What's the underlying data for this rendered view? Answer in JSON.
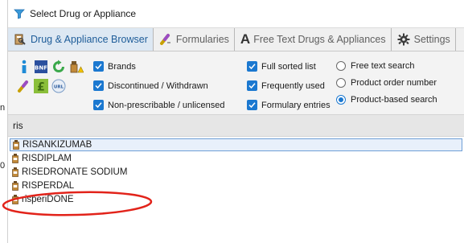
{
  "behind_window": {
    "glyph_a": "n",
    "glyph_b": "0"
  },
  "window": {
    "title": "Select Drug or Appliance",
    "icon": "funnel-icon"
  },
  "tabs": [
    {
      "label": "Drug & Appliance Browser",
      "icon": "book-icon",
      "active": true
    },
    {
      "label": "Formularies",
      "icon": "pill-icon",
      "active": false
    },
    {
      "label": "Free Text Drugs & Appliances",
      "icon": "letter-a-icon",
      "active": false
    },
    {
      "label": "Settings",
      "icon": "gear-icon",
      "active": false
    }
  ],
  "toolbar": {
    "icons": {
      "info": "info-icon",
      "bnf": "BNF",
      "refresh": "refresh-icon",
      "flask": "flask-warning-icon",
      "pill": "pill-icon",
      "pound": "£",
      "url": "URL"
    },
    "checkboxes": [
      {
        "label": "Brands",
        "checked": true
      },
      {
        "label": "Discontinued / Withdrawn",
        "checked": true
      },
      {
        "label": "Non-prescribable / unlicensed",
        "checked": true
      },
      {
        "label": "Full sorted list",
        "checked": true
      },
      {
        "label": "Frequently used",
        "checked": true
      },
      {
        "label": "Formulary entries",
        "checked": true
      }
    ],
    "radios": [
      {
        "label": "Free text search",
        "selected": false
      },
      {
        "label": "Product order number",
        "selected": false
      },
      {
        "label": "Product-based search",
        "selected": true
      }
    ]
  },
  "search": {
    "value": "ris"
  },
  "results": [
    {
      "name": "RISANKIZUMAB",
      "selected": true
    },
    {
      "name": "RISDIPLAM",
      "selected": false
    },
    {
      "name": "RISEDRONATE SODIUM",
      "selected": false
    },
    {
      "name": "RISPERDAL",
      "selected": false
    },
    {
      "name": "risperiDONE",
      "selected": false,
      "highlighted": true
    }
  ],
  "colors": {
    "accent": "#1b78d0",
    "annotation": "#e2231a",
    "active_tab_text": "#1f5d99"
  }
}
